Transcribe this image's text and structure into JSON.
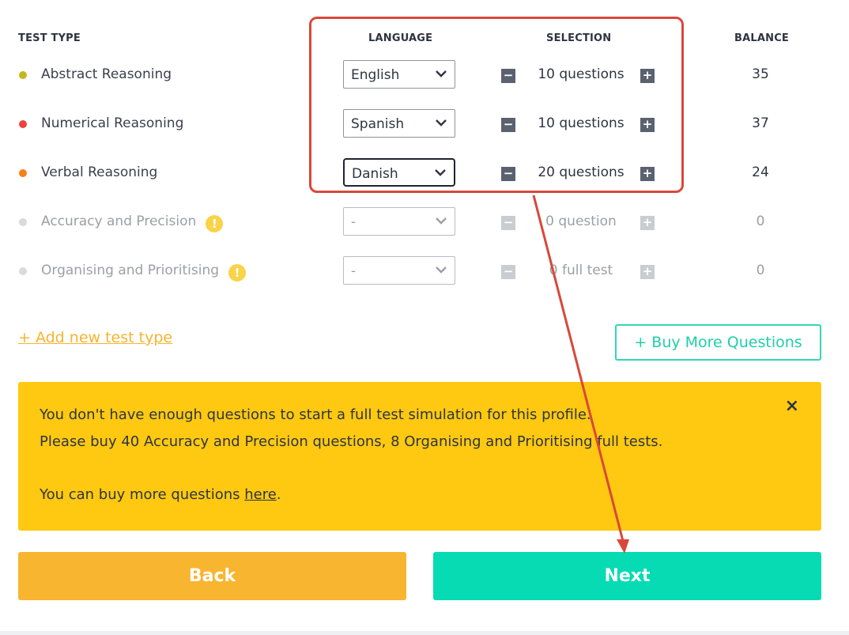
{
  "headers": {
    "test_type": "TEST TYPE",
    "language": "LANGUAGE",
    "selection": "SELECTION",
    "balance": "BALANCE"
  },
  "rows": [
    {
      "name": "Abstract Reasoning",
      "dot_color": "#c3b81f",
      "language": "English",
      "selection": "10 questions",
      "balance": "35",
      "warning": false
    },
    {
      "name": "Numerical Reasoning",
      "dot_color": "#f0413f",
      "language": "Spanish",
      "selection": "10 questions",
      "balance": "37",
      "warning": false
    },
    {
      "name": "Verbal Reasoning",
      "dot_color": "#f77f18",
      "language": "Danish",
      "selection": "20 questions",
      "balance": "24",
      "warning": false
    },
    {
      "name": "Accuracy and Precision",
      "dot_color": "#d8dade",
      "language": "-",
      "selection": "0 question",
      "balance": "0",
      "warning": true
    },
    {
      "name": "Organising and Prioritising",
      "dot_color": "#d8dade",
      "language": "-",
      "selection": "0 full test",
      "balance": "0",
      "warning": true
    }
  ],
  "icons": {
    "minus": "−",
    "plus": "+",
    "warning": "!",
    "close": "×"
  },
  "actions": {
    "add_test_type": "+ Add new test type",
    "buy_more": "+ Buy More Questions",
    "back": "Back",
    "next": "Next"
  },
  "alert": {
    "line1": "You don't have enough questions to start a full test simulation for this profile.",
    "line2": "Please buy 40 Accuracy and Precision questions, 8 Organising and Prioritising full tests.",
    "line3_prefix": "You can buy more questions ",
    "line3_link": "here",
    "line3_suffix": "."
  },
  "colors": {
    "accent_teal": "#06dbb4",
    "accent_orange": "#f8b530",
    "alert_yellow": "#fec910",
    "annotation_red": "#d9483a"
  }
}
